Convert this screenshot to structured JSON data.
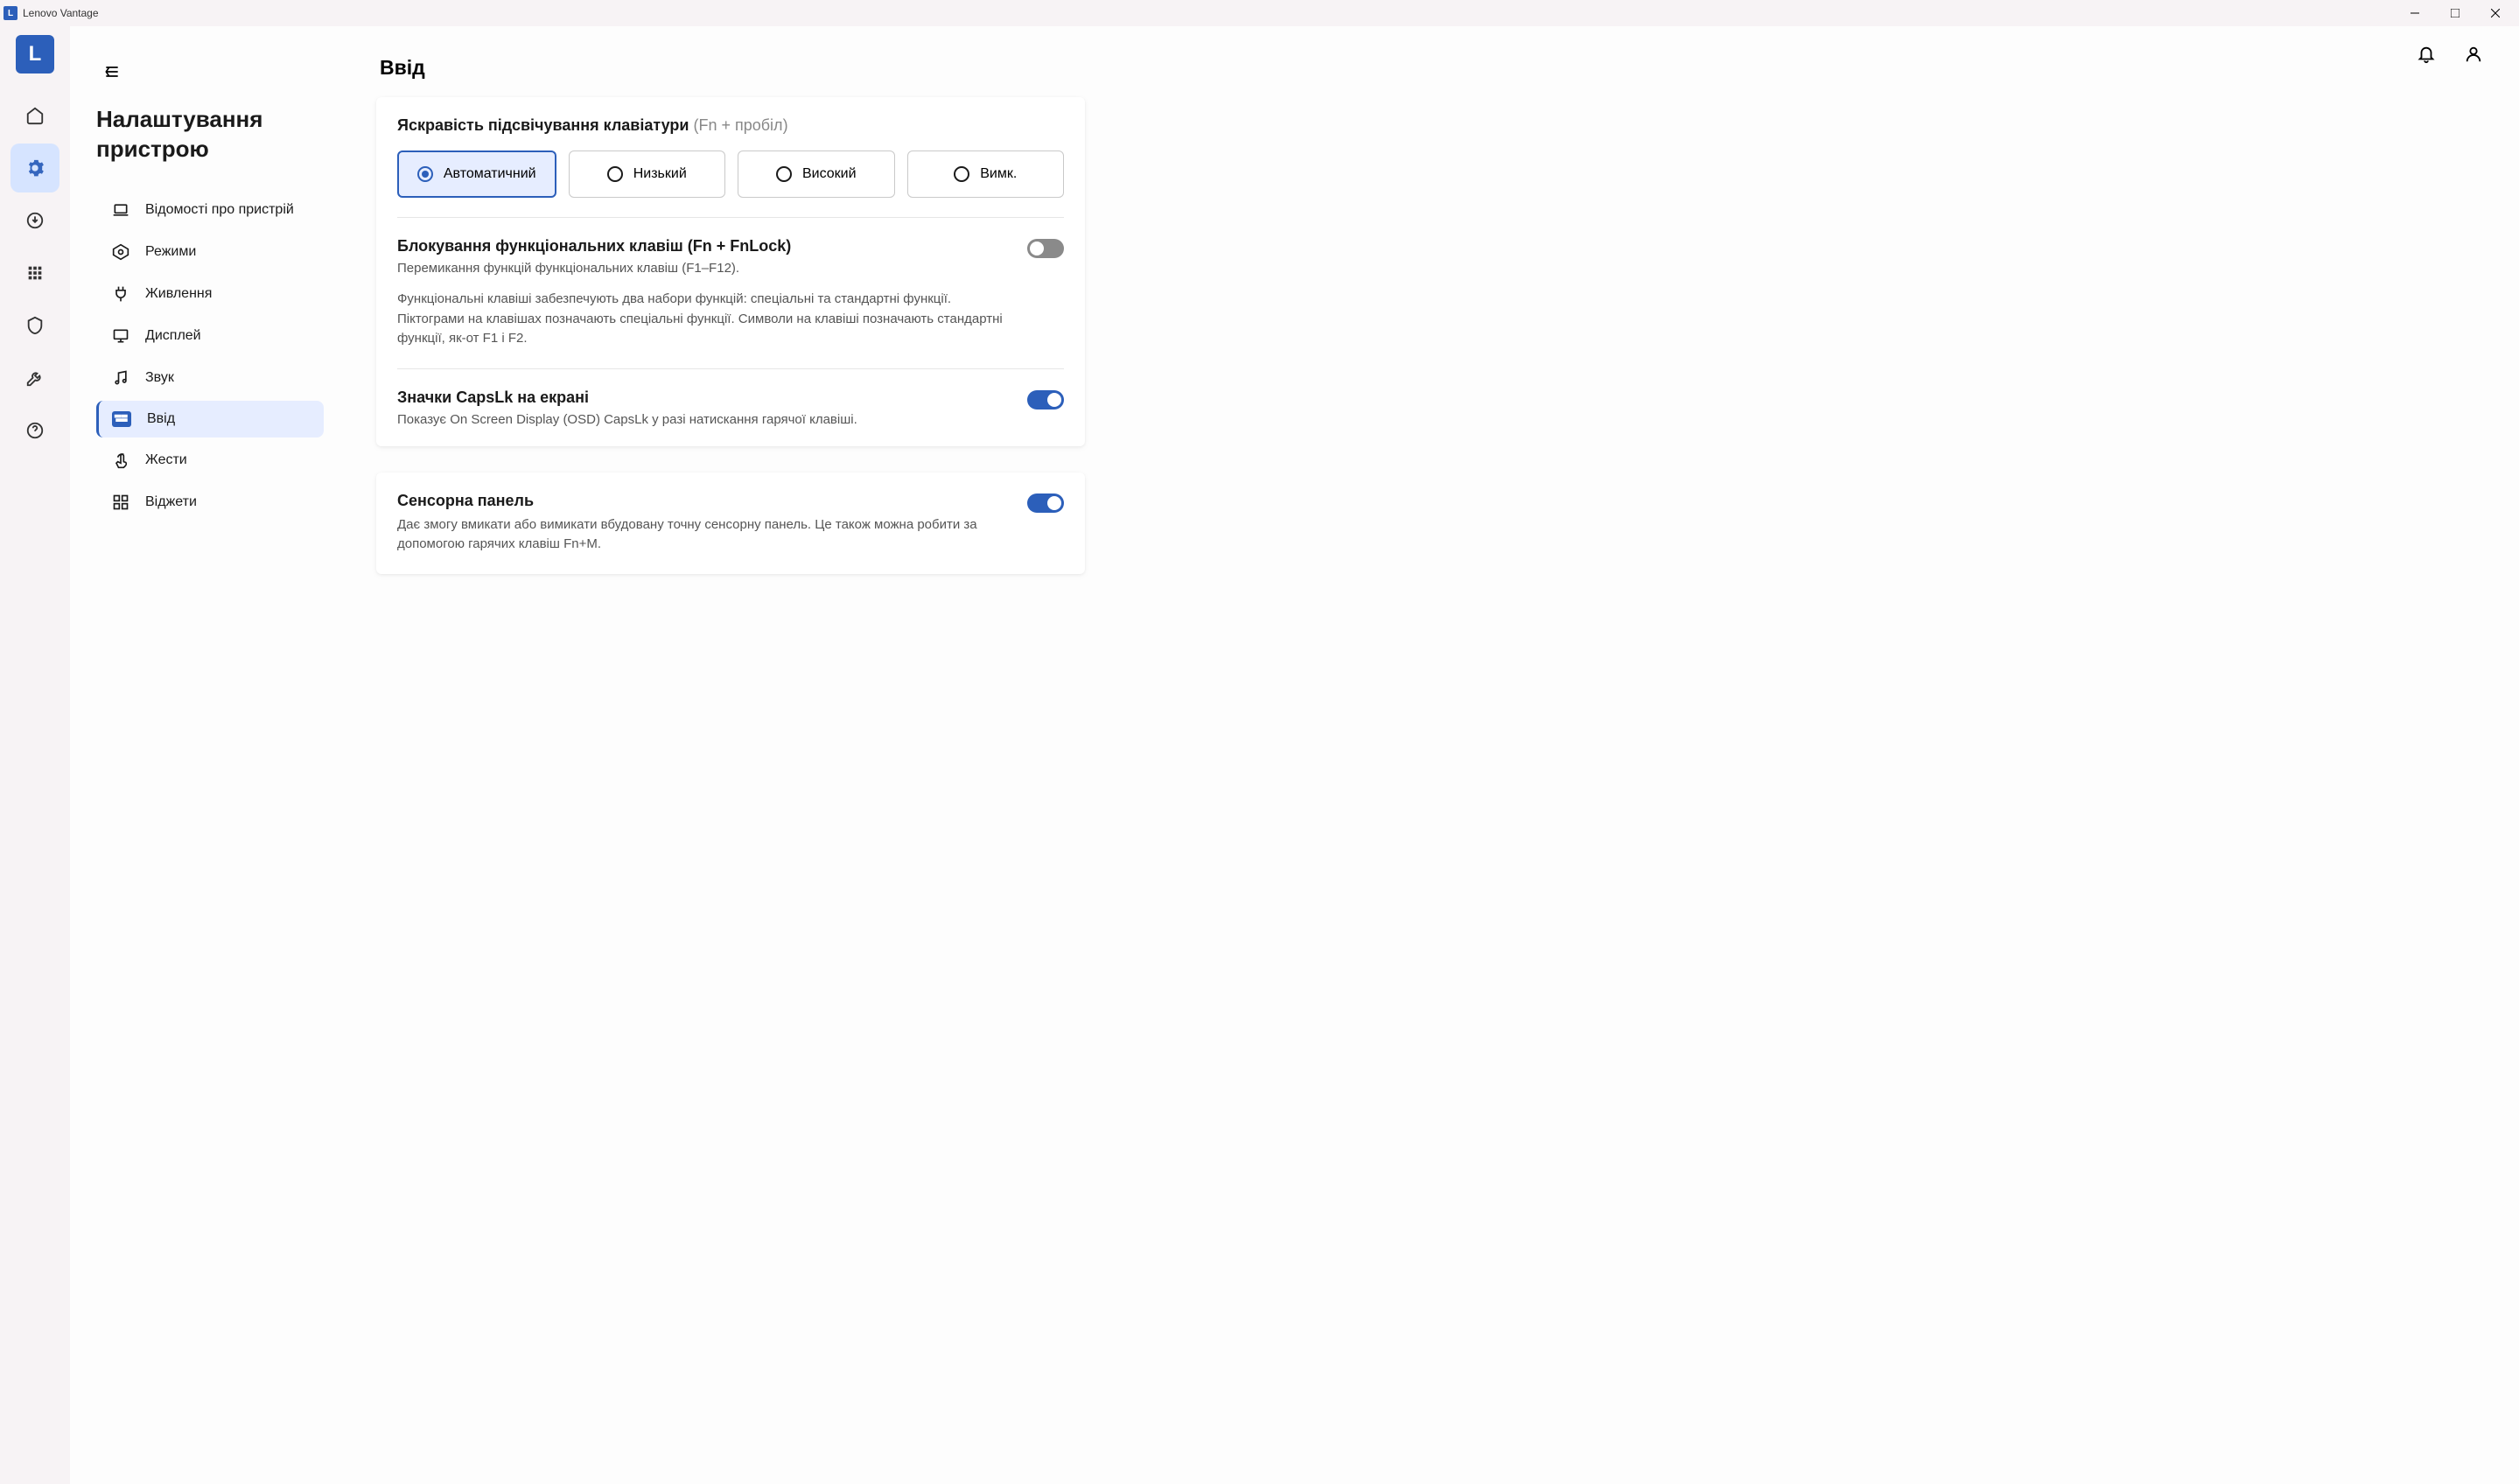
{
  "window": {
    "title": "Lenovo Vantage"
  },
  "logoLetter": "L",
  "settingsTitle": "Налаштування пристрою",
  "nav": {
    "deviceInfo": "Відомості про пристрій",
    "modes": "Режими",
    "power": "Живлення",
    "display": "Дисплей",
    "sound": "Звук",
    "input": "Ввід",
    "gestures": "Жести",
    "widgets": "Віджети"
  },
  "pageTitle": "Ввід",
  "backlight": {
    "title": "Яскравість підсвічування клавіатури ",
    "hint": "(Fn + пробіл)",
    "options": {
      "auto": "Автоматичний",
      "low": "Низький",
      "high": "Високий",
      "off": "Вимк."
    }
  },
  "fnlock": {
    "title": "Блокування функціональних клавіш (Fn + FnLock)",
    "subtitle": "Перемикання функцій функціональних клавіш (F1–F12).",
    "desc": "Функціональні клавіші забезпечують два набори функцій: спеціальні та стандартні функції. Піктограми на клавішах позначають спеціальні функції. Символи на клавіші позначають стандартні функції, як-от F1 і F2."
  },
  "capslk": {
    "title": "Значки CapsLk на екрані",
    "subtitle": "Показує On Screen Display (OSD) CapsLk у разі натискання гарячої клавіші."
  },
  "touchpad": {
    "title": "Сенсорна панель",
    "desc": "Дає змогу вмикати або вимикати вбудовану точну сенсорну панель. Це також можна робити за допомогою гарячих клавіш Fn+M."
  }
}
